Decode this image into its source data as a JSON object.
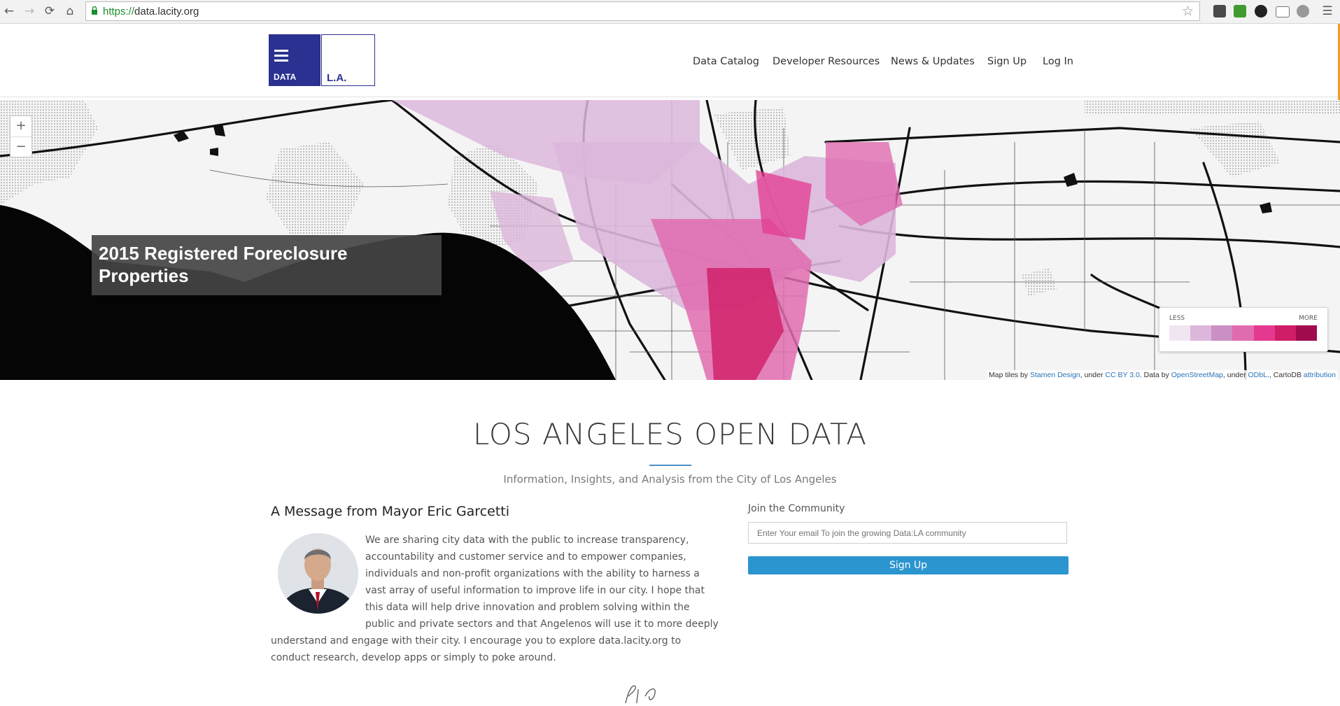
{
  "browser": {
    "url_scheme": "https://",
    "url_host": "data.lacity.org",
    "back_icon": "arrow-left-icon",
    "forward_icon": "arrow-right-icon",
    "reload_icon": "reload-icon",
    "home_icon": "home-icon"
  },
  "site": {
    "logo_left_text": "DATA",
    "logo_right_text": "L.A.",
    "brand_color": "#2b3190",
    "nav": [
      "Data Catalog",
      "Developer Resources",
      "News & Updates",
      "Sign Up",
      "Log In"
    ]
  },
  "map": {
    "zoom_in": "+",
    "zoom_out": "−",
    "caption": "2015 Registered Foreclosure Properties",
    "legend_less": "LESS",
    "legend_more": "MORE",
    "legend_colors": [
      "#f0e6f1",
      "#dcb7db",
      "#cc8fc4",
      "#e06cb0",
      "#e33a8f",
      "#cf1d67",
      "#a10c4f"
    ],
    "attribution": {
      "p1": "Map tiles by ",
      "l1": "Stamen Design",
      "p2": ", under ",
      "l2": "CC BY 3.0",
      "p3": ". Data by ",
      "l3": "OpenStreetMap",
      "p4": ", under ",
      "l4": "ODbL",
      "p5": "., CartoDB ",
      "l5": "attribution"
    }
  },
  "main": {
    "title": "LOS ANGELES OPEN DATA",
    "subtitle": "Information, Insights, and Analysis from the City of Los Angeles",
    "mayor_heading": "A Message from Mayor Eric Garcetti",
    "mayor_message": "We are sharing city data with the public to increase transparency, accountability and customer service and to empower companies, individuals and non-profit organizations with the ability to harness a vast array of useful information to improve life in our city. I hope that this data will help drive innovation and problem solving within the public and private sectors and that Angelenos will use it to more deeply understand and engage with their city. I encourage you to explore data.lacity.org to conduct research, develop apps or simply to poke around.",
    "join_label": "Join the Community",
    "email_placeholder": "Enter Your email To join the growing Data:LA community",
    "signup_button": "Sign Up"
  }
}
